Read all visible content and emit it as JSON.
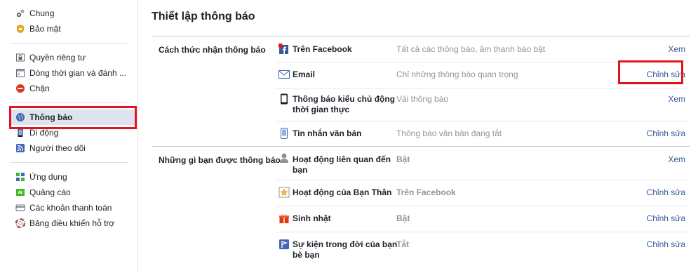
{
  "sidebar": {
    "group1": [
      {
        "label": "Chung",
        "icon": "gears-icon"
      },
      {
        "label": "Bảo mật",
        "icon": "security-badge-icon"
      }
    ],
    "group2": [
      {
        "label": "Quyền riêng tư",
        "icon": "privacy-lock-icon"
      },
      {
        "label": "Dòng thời gian và đánh ...",
        "icon": "timeline-icon"
      },
      {
        "label": "Chặn",
        "icon": "block-icon"
      }
    ],
    "group3": [
      {
        "label": "Thông báo",
        "icon": "globe-icon",
        "active": true
      },
      {
        "label": "Di động",
        "icon": "mobile-icon"
      },
      {
        "label": "Người theo dõi",
        "icon": "rss-icon"
      }
    ],
    "group4": [
      {
        "label": "Ứng dụng",
        "icon": "apps-icon"
      },
      {
        "label": "Quảng cáo",
        "icon": "ads-icon"
      },
      {
        "label": "Các khoản thanh toán",
        "icon": "credit-card-icon"
      },
      {
        "label": "Bảng điều khiển hỗ trợ",
        "icon": "lifebuoy-icon"
      }
    ]
  },
  "main": {
    "title": "Thiết lập thông báo",
    "sections": [
      {
        "title": "Cách thức nhận thông báo",
        "rows": [
          {
            "name": "Trên Facebook",
            "value": "Tất cả các thông báo, âm thanh báo bật",
            "action": "Xem",
            "icon": "facebook-notification-icon"
          },
          {
            "name": "Email",
            "value": "Chỉ những thông báo quan trọng",
            "action": "Chỉnh sửa",
            "icon": "envelope-icon"
          },
          {
            "name": "Thông báo kiểu chủ động thời gian thực",
            "value": "Vài thông báo",
            "action": "Xem",
            "icon": "phone-icon"
          },
          {
            "name": "Tin nhắn văn bản",
            "value": "Thông báo văn bản đang tắt",
            "action": "Chỉnh sửa",
            "icon": "sms-phone-icon"
          }
        ]
      },
      {
        "title": "Những gì bạn được thông báo",
        "rows": [
          {
            "name": "Hoạt động liên quan đến bạn",
            "value": "Bật",
            "action": "Xem",
            "icon": "person-icon"
          },
          {
            "name": "Hoạt động của Bạn Thân",
            "value": "Trên Facebook",
            "action": "Chỉnh sửa",
            "icon": "star-friend-icon"
          },
          {
            "name": "Sinh nhật",
            "value": "Bật",
            "action": "Chỉnh sửa",
            "icon": "gift-icon"
          },
          {
            "name": "Sự kiện trong đời của bạn bè bạn",
            "value": "Tắt",
            "action": "Chỉnh sửa",
            "icon": "life-event-flag-icon"
          }
        ]
      }
    ]
  },
  "colors": {
    "link": "#365899",
    "highlight": "#e3141f",
    "muted": "#90949c",
    "active_bg": "#dfe3ee"
  }
}
